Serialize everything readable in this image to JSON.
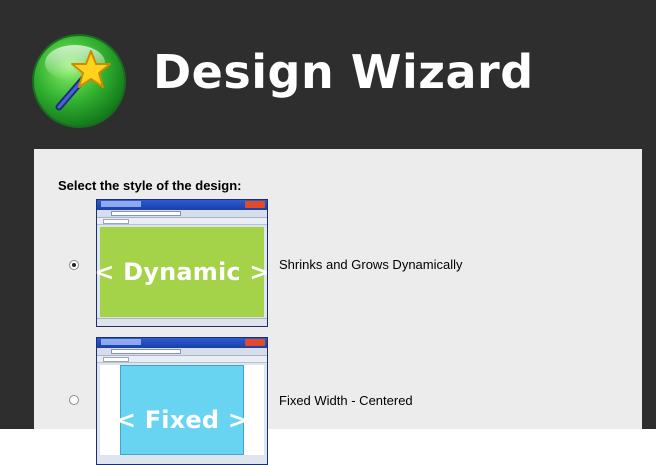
{
  "header": {
    "title": "Design Wizard",
    "logo_icon": "magic-wand-star-icon"
  },
  "content": {
    "prompt": "Select the style of the design:",
    "options": [
      {
        "thumbnail_label": "< Dynamic >",
        "label": "Shrinks and Grows Dynamically",
        "selected": true,
        "thumbnail_color": "#a4d34a"
      },
      {
        "thumbnail_label": "< Fixed >",
        "label": "Fixed Width - Centered",
        "selected": false,
        "thumbnail_color": "#69d4f2"
      }
    ]
  },
  "colors": {
    "header_bg": "#2e2e2e",
    "content_bg": "#ececec",
    "title_text": "#ffffff"
  }
}
